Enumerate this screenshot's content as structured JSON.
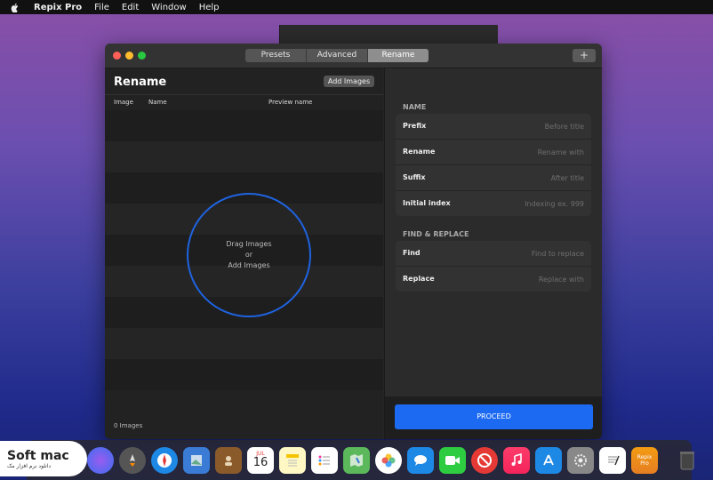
{
  "menubar": {
    "app_name": "Repix Pro",
    "items": [
      "File",
      "Edit",
      "Window",
      "Help"
    ]
  },
  "window": {
    "tabs": [
      {
        "label": "Presets"
      },
      {
        "label": "Advanced"
      },
      {
        "label": "Rename",
        "active": true
      }
    ],
    "plus_label": "+"
  },
  "left": {
    "title": "Rename",
    "add_images_label": "Add Images",
    "columns": [
      "Image",
      "Name",
      "Preview name"
    ],
    "drop_zone": {
      "line1": "Drag Images",
      "line2": "or",
      "line3": "Add Images"
    },
    "count_label": "0 Images"
  },
  "right": {
    "name_section": {
      "heading": "NAME",
      "fields": [
        {
          "label": "Prefix",
          "placeholder": "Before title"
        },
        {
          "label": "Rename",
          "placeholder": "Rename with"
        },
        {
          "label": "Suffix",
          "placeholder": "After title"
        },
        {
          "label": "Initial index",
          "placeholder": "Indexing ex. 999"
        }
      ]
    },
    "find_section": {
      "heading": "FIND & REPLACE",
      "fields": [
        {
          "label": "Find",
          "placeholder": "Find to replace"
        },
        {
          "label": "Replace",
          "placeholder": "Replace with"
        }
      ]
    },
    "proceed_label": "PROCEED"
  },
  "dock": {
    "calendar_month": "JUL",
    "calendar_day": "16",
    "repix_label_top": "Repix",
    "repix_label_bottom": "Pro"
  },
  "watermark": {
    "title": "Soft mac",
    "subtitle": "دانلود نرم افزار مک"
  },
  "colors": {
    "accent": "#1c6af2",
    "drop_circle": "#1f63e0"
  }
}
